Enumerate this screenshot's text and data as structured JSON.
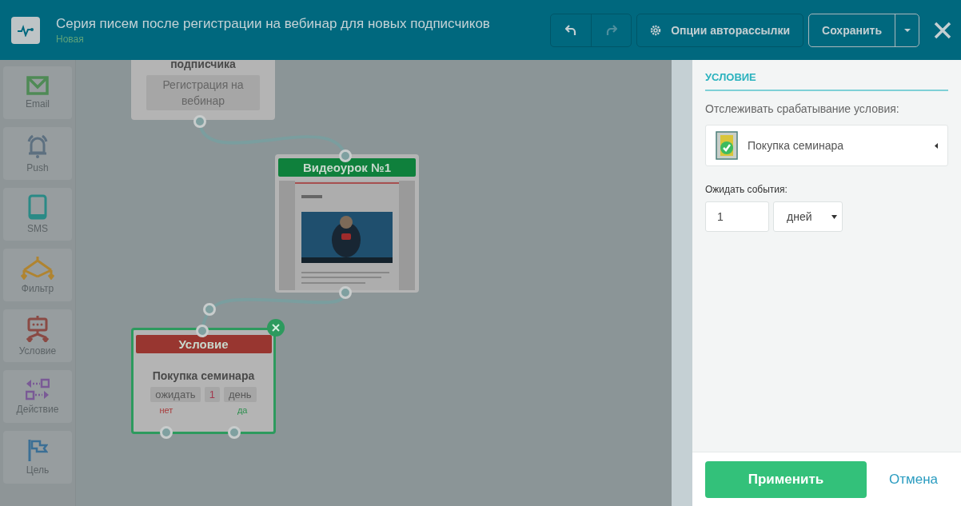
{
  "header": {
    "title": "Серия писем после регистрации на вебинар для новых подписчиков",
    "status": "Новая",
    "history_buttons": [
      {
        "kind": "undo",
        "disabled": false
      },
      {
        "kind": "redo",
        "disabled": true
      }
    ],
    "options_button": "Опции авторассылки",
    "save_button": "Сохранить"
  },
  "tools": [
    {
      "kind": "email",
      "label": "Email"
    },
    {
      "kind": "push",
      "label": "Push"
    },
    {
      "kind": "sms",
      "label": "SMS"
    },
    {
      "kind": "filter",
      "label": "Фильтр"
    },
    {
      "kind": "condition",
      "label": "Условие"
    },
    {
      "kind": "action",
      "label": "Действие"
    },
    {
      "kind": "goal",
      "label": "Цель"
    }
  ],
  "nodes": [
    {
      "kind": "trigger",
      "title": "подписчика",
      "tag": "Регистрация на вебинар",
      "selected": false
    },
    {
      "kind": "email",
      "title": "Видеоурок №1",
      "selected": false
    },
    {
      "kind": "condition",
      "title": "Условие",
      "event": "Покупка семинара",
      "wait_word": "ожидать",
      "wait_value": "1",
      "wait_unit": "день",
      "no_label": "нет",
      "yes_label": "да",
      "selected": true
    }
  ],
  "panel": {
    "section_title": "УСЛОВИЕ",
    "track_label": "Отслеживать срабатывание условия:",
    "event": "Покупка семинара",
    "wait_label": "Ожидать события:",
    "wait_value": "1",
    "wait_unit": "дней",
    "apply_button": "Применить",
    "cancel_link": "Отмена"
  }
}
